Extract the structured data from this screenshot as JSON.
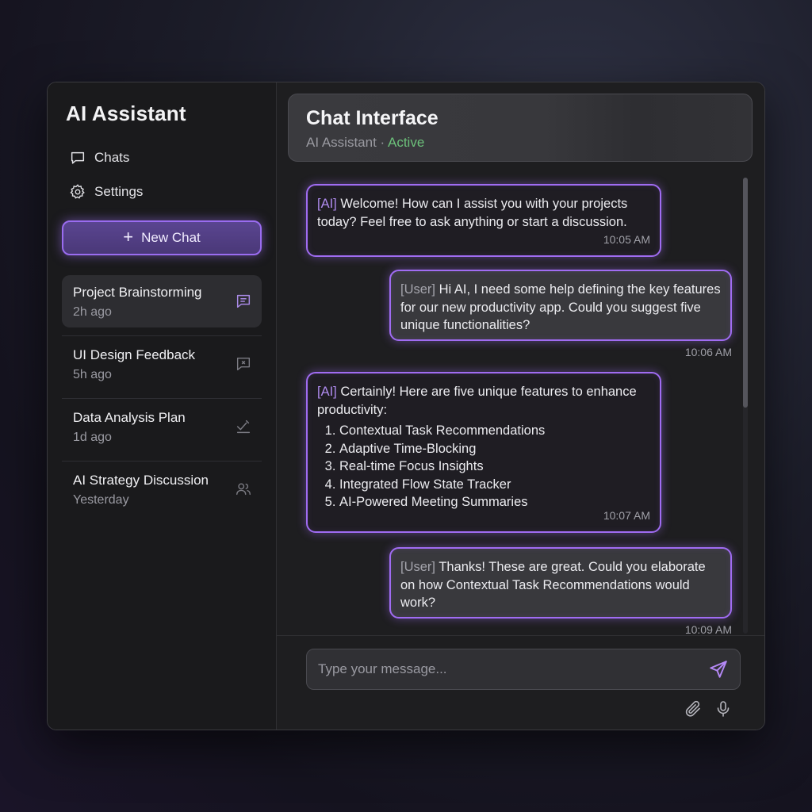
{
  "sidebar": {
    "app_title": "AI Assistant",
    "nav": [
      {
        "label": "Chats",
        "icon": "chat-bubble-icon"
      },
      {
        "label": "Settings",
        "icon": "gear-icon"
      }
    ],
    "new_chat": {
      "label": "New Chat",
      "icon": "plus-icon"
    },
    "conversations": [
      {
        "title": "Project Brainstorming",
        "time": "2h ago",
        "icon": "message-icon",
        "active": true
      },
      {
        "title": "UI Design Feedback",
        "time": "5h ago",
        "icon": "feedback-icon",
        "active": false
      },
      {
        "title": "Data Analysis Plan",
        "time": "1d ago",
        "icon": "checklist-icon",
        "active": false
      },
      {
        "title": "AI Strategy Discussion",
        "time": "Yesterday",
        "icon": "users-icon",
        "active": false
      }
    ]
  },
  "header": {
    "title": "Chat Interface",
    "subtitle": "AI Assistant",
    "separator": " · ",
    "status": "Active"
  },
  "messages": [
    {
      "role": "ai",
      "tag": "[AI]",
      "text": "Welcome! How can I assist you with your projects today? Feel free to ask anything or start a discussion.",
      "time": "10:05 AM"
    },
    {
      "role": "user",
      "tag": "[User]",
      "text": "Hi AI, I need some help defining the key features for our new productivity app. Could you suggest five unique functionalities?",
      "time": "10:06 AM"
    },
    {
      "role": "ai",
      "tag": "[AI]",
      "text": "Certainly! Here are five unique features to enhance productivity:",
      "list": [
        "Contextual Task Recommendations",
        "Adaptive Time-Blocking",
        "Real-time Focus Insights",
        "Integrated Flow State Tracker",
        "AI-Powered Meeting Summaries"
      ],
      "time": "10:07 AM"
    },
    {
      "role": "user",
      "tag": "[User]",
      "text": "Thanks! These are great. Could you elaborate on how Contextual Task Recommendations would work?",
      "time": "10:09 AM"
    }
  ],
  "composer": {
    "placeholder": "Type your message...",
    "send_icon": "send-icon",
    "attach_icon": "paperclip-icon",
    "mic_icon": "microphone-icon"
  },
  "colors": {
    "accent": "#a06cf2",
    "status_active": "#6cc07a",
    "background": "#161618"
  }
}
